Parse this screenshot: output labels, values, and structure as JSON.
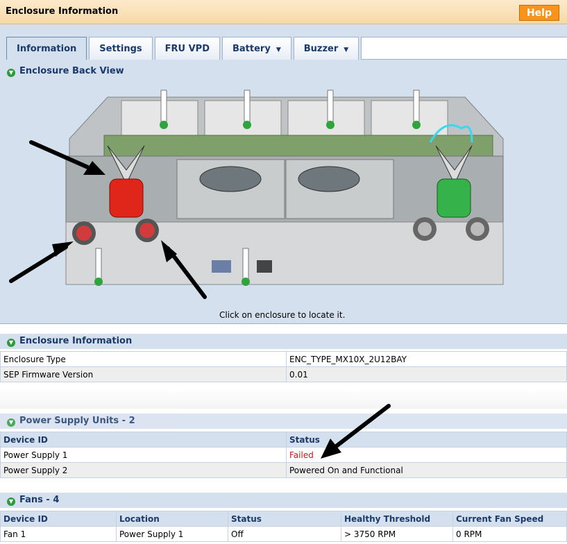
{
  "header": {
    "title": "Enclosure Information",
    "help_label": "Help"
  },
  "tabs": [
    {
      "label": "Information",
      "active": true,
      "dropdown": false
    },
    {
      "label": "Settings",
      "active": false,
      "dropdown": false
    },
    {
      "label": "FRU VPD",
      "active": false,
      "dropdown": false
    },
    {
      "label": "Battery",
      "active": false,
      "dropdown": true
    },
    {
      "label": "Buzzer",
      "active": false,
      "dropdown": true
    }
  ],
  "back_view": {
    "title": "Enclosure Back View",
    "caption": "Click on enclosure to locate it."
  },
  "enclosure_info": {
    "title": "Enclosure Information",
    "rows": [
      {
        "label": "Enclosure Type",
        "value": "ENC_TYPE_MX10X_2U12BAY"
      },
      {
        "label": "SEP Firmware Version",
        "value": "0.01"
      }
    ]
  },
  "psu": {
    "title": "Power Supply Units - 2",
    "headers": [
      "Device ID",
      "Status"
    ],
    "rows": [
      {
        "device": "Power Supply 1",
        "status": "Failed"
      },
      {
        "device": "Power Supply 2",
        "status": "Powered On and Functional"
      }
    ]
  },
  "fans": {
    "title": "Fans - 4",
    "headers": [
      "Device ID",
      "Location",
      "Status",
      "Healthy Threshold",
      "Current Fan Speed"
    ],
    "rows": [
      {
        "device": "Fan 1",
        "location": "Power Supply 1",
        "status": "Off",
        "threshold": "> 3750 RPM",
        "speed": "0 RPM"
      }
    ]
  },
  "colors": {
    "header_bg": "#f6d9a6",
    "help_button": "#f7941d",
    "panel_blue": "#d5e0ee",
    "text_blue": "#1a3a6b",
    "failed_red": "#d8111b",
    "warning_red": "#e0261b",
    "ok_green": "#36b24a"
  }
}
